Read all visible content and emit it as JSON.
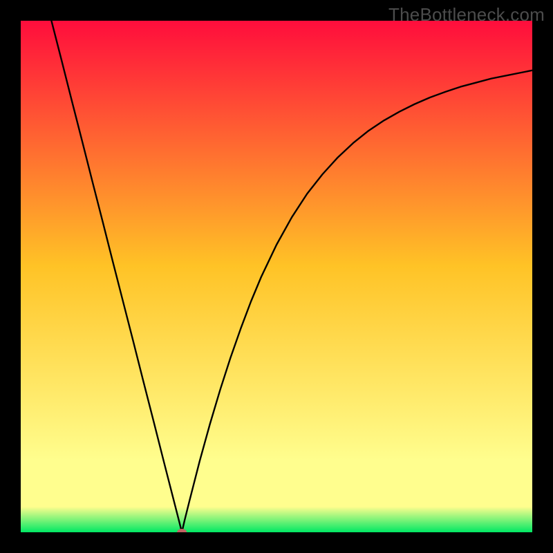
{
  "watermark": "TheBottleneck.com",
  "chart_data": {
    "type": "line",
    "title": "",
    "xlabel": "",
    "ylabel": "",
    "xlim": [
      0,
      1
    ],
    "ylim": [
      0,
      1
    ],
    "grid": false,
    "legend": false,
    "gradient": {
      "top_color": "#ff0d3c",
      "mid_color": "#ffc326",
      "yellow_band_color": "#fffe8e",
      "bottom_color": "#00e864"
    },
    "minimum_marker": {
      "x": 0.315,
      "y": 0.0,
      "color": "#c26363"
    },
    "series": [
      {
        "name": "bottleneck-curve",
        "color": "#000000",
        "x": [
          0.06,
          0.08,
          0.1,
          0.12,
          0.14,
          0.16,
          0.18,
          0.2,
          0.22,
          0.24,
          0.26,
          0.28,
          0.3,
          0.31,
          0.315,
          0.32,
          0.33,
          0.35,
          0.37,
          0.39,
          0.41,
          0.43,
          0.45,
          0.47,
          0.5,
          0.53,
          0.56,
          0.59,
          0.62,
          0.65,
          0.68,
          0.71,
          0.74,
          0.77,
          0.8,
          0.83,
          0.86,
          0.89,
          0.92,
          0.95,
          0.98,
          1.0
        ],
        "y": [
          1.0,
          0.922,
          0.843,
          0.765,
          0.686,
          0.608,
          0.529,
          0.451,
          0.373,
          0.294,
          0.216,
          0.137,
          0.059,
          0.02,
          0.0,
          0.022,
          0.062,
          0.14,
          0.212,
          0.279,
          0.341,
          0.398,
          0.451,
          0.499,
          0.562,
          0.616,
          0.662,
          0.7,
          0.733,
          0.761,
          0.785,
          0.805,
          0.822,
          0.837,
          0.85,
          0.861,
          0.871,
          0.879,
          0.887,
          0.893,
          0.899,
          0.903
        ]
      }
    ]
  }
}
